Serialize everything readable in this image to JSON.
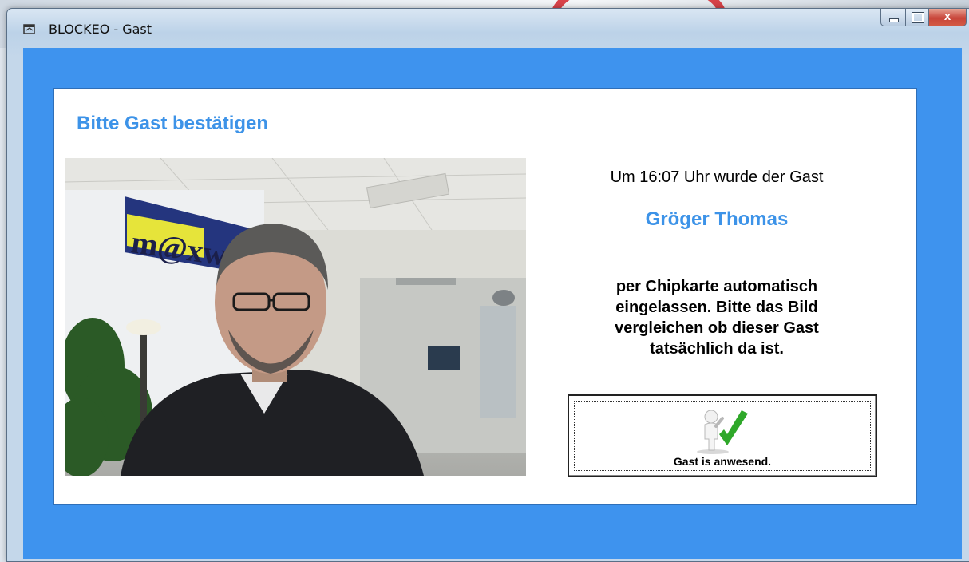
{
  "window": {
    "title": "BLOCKEO - Gast",
    "close_glyph": "x",
    "app_icon": "window-app-icon"
  },
  "dialog": {
    "heading": "Bitte Gast bestätigen",
    "line1": "Um 16:07 Uhr wurde der Gast",
    "guest_name": "Gröger Thomas",
    "body": "per Chipkarte automatisch eingelassen. Bitte das Bild vergleichen ob dieser Gast tatsächlich da ist.",
    "confirm_label": "Gast is anwesend.",
    "confirm_icon": "person-checkmark-icon"
  },
  "colors": {
    "client_background": "#3e93ee",
    "heading_blue": "#3d93e8",
    "check_green": "#2fa82a"
  },
  "photo": {
    "content": "webcam-photo-of-guest",
    "wall_logo": "m@xw"
  }
}
